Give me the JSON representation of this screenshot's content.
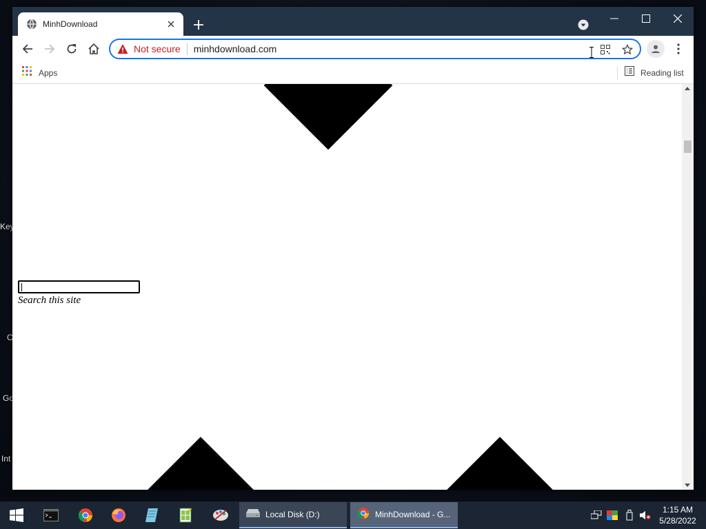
{
  "desktop": {
    "labels": [
      "Key",
      "C",
      "Go",
      "Int"
    ]
  },
  "browser": {
    "tab_title": "MinhDownload",
    "tab_favicon": "globe-icon",
    "security_label": "Not secure",
    "url": "minhdownload.com",
    "bookmarks": {
      "apps_label": "Apps",
      "reading_list_label": "Reading list"
    }
  },
  "page": {
    "search_value": "",
    "search_caption": "Search this site"
  },
  "taskbar": {
    "windows": [
      {
        "label": "Local Disk (D:)",
        "icon": "drive-icon"
      },
      {
        "label": "MinhDownload - G...",
        "icon": "chrome-icon"
      }
    ],
    "clock": {
      "time": "1:15 AM",
      "date": "5/28/2022"
    }
  },
  "colors": {
    "titlebar": "#233446",
    "focus_ring": "#1a73e8",
    "not_secure": "#c5221f",
    "taskbar": "#1b2533"
  }
}
